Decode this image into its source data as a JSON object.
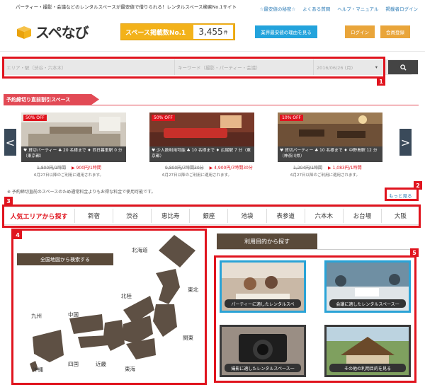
{
  "header": {
    "tagline": "パーティー・撮影・会議などのレンタルスペースが最安値で借りられる！レンタルスペース検索No.1サイト",
    "links": [
      "☆最安値の秘密☆",
      "よくある質問",
      "ヘルプ・マニュアル",
      "掲載者ログイン"
    ],
    "logo_text": "スペなび",
    "badge_label": "スペース掲載数No.1",
    "badge_count": "3,455",
    "badge_unit": "件",
    "reason_button": "業界最安値の理由を見る",
    "login_button": "ログイン",
    "register_button": "会員登録"
  },
  "search": {
    "area_placeholder": "エリア・駅（渋谷・六本木）",
    "keyword_placeholder": "キーワード（撮影・パーティー・会議）",
    "date_value": "2016/06/26 (月)",
    "chevron": "▾",
    "search_icon": "search-icon"
  },
  "deals": {
    "title": "予約締切り直前割引スペース",
    "prev": "<",
    "next": ">",
    "cards": [
      {
        "off": "50% OFF",
        "meta": "♥ 貸切パーティー ♣ 20 名様まで ♦ 西日暮里駅 0 分（東京都）",
        "old_price": "1,800円/1時間",
        "new_price": "▶ 900円/1時間",
        "valid": "6月27日以降のご利用に適用されます。"
      },
      {
        "off": "50% OFF",
        "meta": "♥ 少人数利用可能 ♣ 10 名様まで ♦ 広尾駅 7 分（東京都）",
        "old_price": "9,800円/7時間30分",
        "new_price": "▶ 4,900円/7時間30分",
        "valid": "6月27日以降のご利用に適用されます。"
      },
      {
        "off": "10% OFF",
        "meta": "♥ 貸切パーティー ♣ 10 名様まで ♦ 中野島駅 12 分（神奈川県）",
        "old_price": "1,204円/1時間",
        "new_price": "▶ 1,083円/1時間",
        "valid": "6月27日以降のご利用に適用されます。"
      }
    ],
    "note": "※ 予約締切直前のスペースのため通常料金よりもお得な料金で使用可能です。",
    "more": "もっと見る"
  },
  "areas": {
    "title": "人気エリアから探す",
    "items": [
      "新宿",
      "渋谷",
      "恵比寿",
      "銀座",
      "池袋",
      "表参道",
      "六本木",
      "お台場",
      "大阪"
    ]
  },
  "map": {
    "title": "全国地図から検索する",
    "regions": {
      "hokkaido": "北海道",
      "tohoku": "東北",
      "hokuriku": "北陸",
      "kanto": "関東",
      "chugoku": "中国",
      "kyushu": "九州",
      "shikoku": "四国",
      "kinki": "近畿",
      "tokai": "東海",
      "okinawa": "沖縄"
    }
  },
  "purposes": {
    "title": "利用目的から探す",
    "tiles": [
      "パーティーに適したレンタルスペ",
      "会議に適したレンタルスペース一",
      "撮影に適したレンタルスペース一",
      "その他の利用目的を見る"
    ]
  },
  "markers": [
    "1",
    "2",
    "3",
    "4",
    "5"
  ],
  "colors": {
    "highlight": "#e0141e",
    "accent": "#f3b21a",
    "link": "#2a7ab5",
    "brown": "#5a4a3a"
  }
}
